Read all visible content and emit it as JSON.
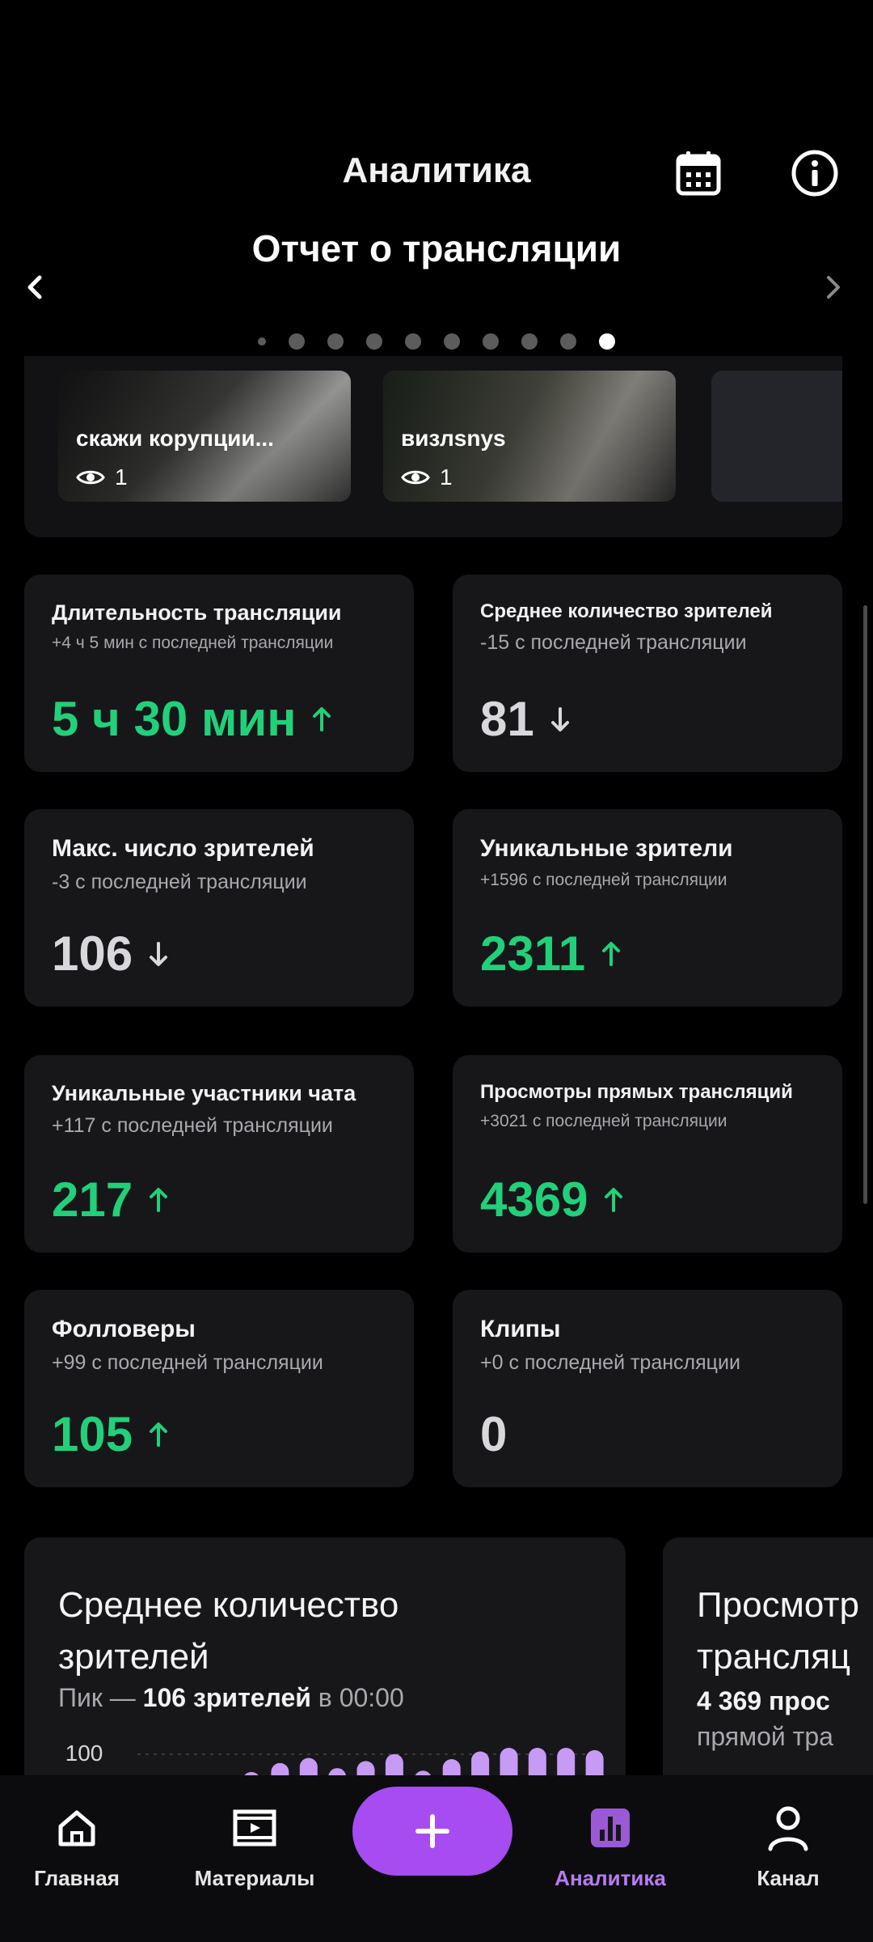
{
  "header": {
    "title": "Аналитика",
    "subtitle": "Отчет о трансляции"
  },
  "pager": {
    "count": 10,
    "active_index": 9
  },
  "clips": [
    {
      "title": "скажи корупции...",
      "views": "1"
    },
    {
      "title": "визлsnys",
      "views": "1"
    }
  ],
  "stats": [
    {
      "title": "Длительность трансляции",
      "delta": "+4 ч 5 мин с последней трансляции",
      "value": "5 ч 30 мин",
      "trend": "up"
    },
    {
      "title": "Среднее количество зрителей",
      "delta": "-15 с последней трансляции",
      "value": "81",
      "trend": "down"
    },
    {
      "title": "Макс. число зрителей",
      "delta": "-3 с последней трансляции",
      "value": "106",
      "trend": "down"
    },
    {
      "title": "Уникальные зрители",
      "delta": "+1596 с последней трансляции",
      "value": "2311",
      "trend": "up"
    },
    {
      "title": "Уникальные участники чата",
      "delta": "+117 с последней трансляции",
      "value": "217",
      "trend": "up"
    },
    {
      "title": "Просмотры прямых трансляций",
      "delta": "+3021 с последней трансляции",
      "value": "4369",
      "trend": "up"
    },
    {
      "title": "Фолловеры",
      "delta": "+99 с последней трансляции",
      "value": "105",
      "trend": "up"
    },
    {
      "title": "Клипы",
      "delta": "+0 с последней трансляции",
      "value": "0",
      "trend": "none"
    }
  ],
  "avg_viewers_card": {
    "title": "Среднее количество зрителей",
    "peak_prefix": "Пик —",
    "peak_value": "106 зрителей",
    "peak_suffix": "в 00:00",
    "axis_label": "100"
  },
  "live_views_card": {
    "title_line1": "Просмотр",
    "title_line2": "трансляц",
    "sub1": "4 369 прос",
    "sub2": "прямой тра"
  },
  "bottom_nav": {
    "home": "Главная",
    "materials": "Материалы",
    "add": "+",
    "analytics": "Аналитика",
    "channel": "Канал"
  },
  "colors": {
    "background": "#000000",
    "card": "#17171a",
    "positive": "#22d07a",
    "accent": "#a64cf0",
    "accent_text": "#b77cf2"
  },
  "chart_data": {
    "type": "bar",
    "title": "Среднее количество зрителей",
    "ylim": [
      0,
      106
    ],
    "yticks": [
      100
    ],
    "values": [
      38,
      52,
      60,
      44,
      55,
      66,
      40,
      58,
      70,
      78,
      82,
      96,
      72
    ]
  }
}
